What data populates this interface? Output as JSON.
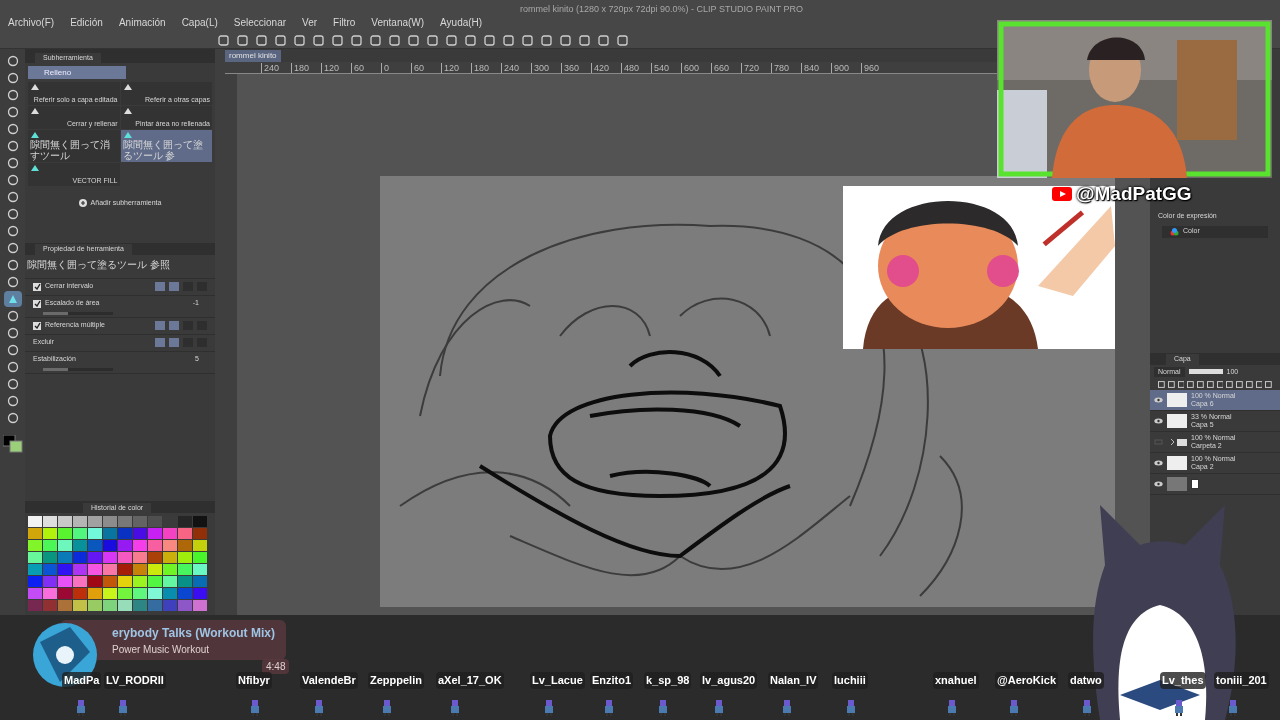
{
  "window": {
    "title": "rommel kinito (1280 x 720px 72dpi 90.0%)  - CLIP STUDIO PAINT PRO"
  },
  "menu": [
    "Archivo(F)",
    "Edición",
    "Animación",
    "Capa(L)",
    "Seleccionar",
    "Ver",
    "Filtro",
    "Ventana(W)",
    "Ayuda(H)"
  ],
  "document_tab": "rommel kinito",
  "ruler": [
    "240",
    "180",
    "120",
    "60",
    "0",
    "60",
    "120",
    "180",
    "240",
    "300",
    "360",
    "420",
    "480",
    "540",
    "600",
    "660",
    "720",
    "780",
    "840",
    "900",
    "960"
  ],
  "tools": [
    {
      "selected": false
    },
    {
      "selected": false
    },
    {
      "selected": false
    },
    {
      "selected": false
    },
    {
      "selected": false
    },
    {
      "selected": false
    },
    {
      "selected": false
    },
    {
      "selected": false
    },
    {
      "selected": false
    },
    {
      "selected": false
    },
    {
      "selected": false
    },
    {
      "selected": false
    },
    {
      "selected": false
    },
    {
      "selected": false
    },
    {
      "selected": true
    },
    {
      "selected": false
    },
    {
      "selected": false
    },
    {
      "selected": false
    },
    {
      "selected": false
    },
    {
      "selected": false
    },
    {
      "selected": false
    },
    {
      "selected": false
    }
  ],
  "subtool_panel": {
    "tab": "Subherramienta",
    "group": "Relleno",
    "add": "Añadir subherramienta",
    "items": [
      {
        "label": "Referir solo a capa editada",
        "selected": false
      },
      {
        "label": "Referir a otras capas",
        "selected": false
      },
      {
        "label": "Cerrar y rellenar",
        "selected": false
      },
      {
        "label": "Pintar área no rellenada",
        "selected": false
      },
      {
        "label": "隙間無く囲って消すツール",
        "selected": false
      },
      {
        "label": "隙間無く囲って塗るツール 参",
        "selected": true
      },
      {
        "label": "VECTOR FILL",
        "selected": false
      }
    ]
  },
  "tool_property": {
    "tab": "Propiedad de herramienta",
    "tool_name": "隙間無く囲って塗るツール 参照",
    "settings": [
      {
        "kind": "check",
        "label": "Cerrar intervalo",
        "checked": true
      },
      {
        "kind": "slider",
        "label": "Escalado de área",
        "checked": true,
        "value": "-1",
        "level": 0.35
      },
      {
        "kind": "check",
        "label": "Referencia múltiple",
        "checked": true
      },
      {
        "kind": "plain",
        "label": "Excluir"
      },
      {
        "kind": "slider",
        "label": "Estabilización",
        "value": "5",
        "level": 0.35
      }
    ]
  },
  "color_history": {
    "tab": "Historial de color"
  },
  "expression_color": {
    "label": "Color de expresión",
    "value": "Color"
  },
  "layer_panel": {
    "tab": "Capa",
    "blend": "Normal",
    "opacity": "100",
    "opacity_slider": {
      "level": 1
    },
    "layers": [
      {
        "kind": "layer",
        "info": "100 % Normal",
        "name": "Capa 6",
        "visible": true,
        "selected": true
      },
      {
        "kind": "layer",
        "info": "33 % Normal",
        "name": "Capa 5",
        "visible": true,
        "selected": false
      },
      {
        "kind": "folder",
        "info": "100 % Normal",
        "name": "Carpeta 2",
        "visible": false,
        "selected": false
      },
      {
        "kind": "layer",
        "info": "100 % Normal",
        "name": "Capa 2",
        "visible": true,
        "selected": false
      },
      {
        "kind": "paper",
        "visible": true,
        "selected": false
      }
    ]
  },
  "channel": "@MadPatGG",
  "music": {
    "title": "erybody Talks (Workout Mix)",
    "artist": "Power Music Workout",
    "time": "4:48"
  },
  "viewers": [
    "MadPa",
    "LV_RODRII",
    "Nfibyr",
    "ValendeBr",
    "Zepppelin",
    "aXel_17_OK",
    "Lv_Lacue",
    "Enzito1",
    "k_sp_98",
    "lv_agus20",
    "Nalan_IV",
    "luchiii",
    "xnahuel",
    "@AeroKick",
    "datwo",
    "Lv_thes",
    "toniii_201"
  ]
}
